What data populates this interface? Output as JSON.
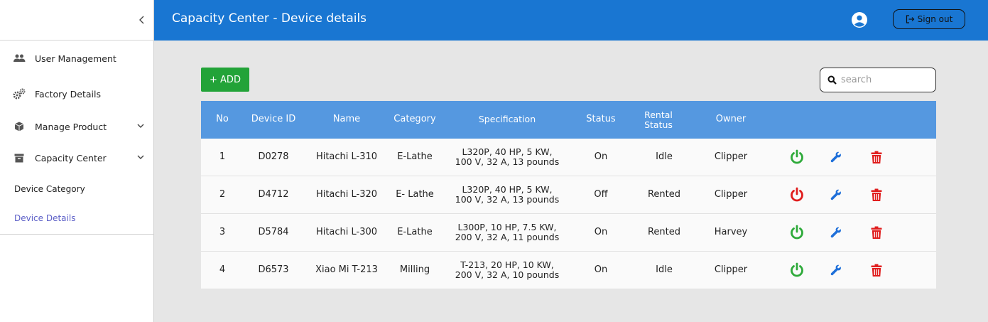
{
  "header": {
    "title": "Capacity Center - Device details",
    "sign_out_label": "Sign out"
  },
  "sidebar": {
    "items": [
      {
        "label": "User Management",
        "icon": "users-icon"
      },
      {
        "label": "Factory Details",
        "icon": "gears-icon"
      },
      {
        "label": "Manage Product",
        "icon": "box-icon",
        "expandable": true
      },
      {
        "label": "Capacity Center",
        "icon": "archive-icon",
        "expandable": true
      }
    ],
    "subitems": [
      {
        "label": "Device Category",
        "active": false
      },
      {
        "label": "Device Details",
        "active": true
      }
    ]
  },
  "toolbar": {
    "add_label": "+ ADD",
    "search_placeholder": "search"
  },
  "table": {
    "columns": [
      "No",
      "Device ID",
      "Name",
      "Category",
      "Specification",
      "Status",
      "Rental Status",
      "Owner"
    ],
    "rows": [
      {
        "no": "1",
        "device_id": "D0278",
        "name": "Hitachi L-310",
        "category": "E-Lathe",
        "spec_line1": "L320P, 40 HP, 5 KW,",
        "spec_line2": "100 V, 32 A, 13 pounds",
        "status": "On",
        "rental_status": "Idle",
        "owner": "Clipper",
        "power_color": "#2eaa3a"
      },
      {
        "no": "2",
        "device_id": "D4712",
        "name": "Hitachi L-320",
        "category": "E- Lathe",
        "spec_line1": "L320P, 40 HP, 5 KW,",
        "spec_line2": "100 V, 32 A, 13 pounds",
        "status": "Off",
        "rental_status": "Rented",
        "owner": "Clipper",
        "power_color": "#e01e1e"
      },
      {
        "no": "3",
        "device_id": "D5784",
        "name": "Hitachi L-300",
        "category": "E-Lathe",
        "spec_line1": "L300P, 10 HP, 7.5 KW,",
        "spec_line2": "200 V, 32 A, 11 pounds",
        "status": "On",
        "rental_status": "Rented",
        "owner": "Harvey",
        "power_color": "#2eaa3a"
      },
      {
        "no": "4",
        "device_id": "D6573",
        "name": "Xiao Mi T-213",
        "category": "Milling",
        "spec_line1": "T-213, 20 HP, 10 KW,",
        "spec_line2": "200 V, 32 A, 10 pounds",
        "status": "On",
        "rental_status": "Idle",
        "owner": "Clipper",
        "power_color": "#2eaa3a"
      }
    ]
  },
  "colors": {
    "header_bg": "#1976d2",
    "table_header_bg": "#5598e0",
    "add_button": "#22a338",
    "wrench": "#1e6fd9",
    "trash": "#e01e1e",
    "active_link": "#5c5fc7"
  }
}
